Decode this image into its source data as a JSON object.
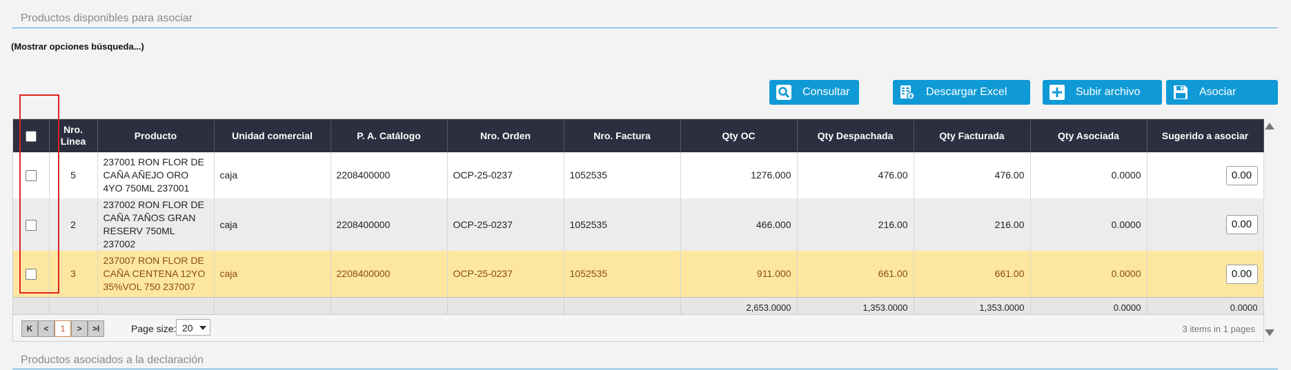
{
  "section_available": {
    "title": "Productos disponibles para asociar"
  },
  "search_toggle": "(Mostrar opciones búsqueda...)",
  "toolbar": {
    "consultar": "Consultar",
    "descargar_excel": "Descargar Excel",
    "subir_archivo": "Subir archivo",
    "asociar": "Asociar"
  },
  "columns": [
    "Nro. Línea",
    "Producto",
    "Unidad comercial",
    "P. A. Catálogo",
    "Nro. Orden",
    "Nro. Factura",
    "Qty OC",
    "Qty Despachada",
    "Qty Facturada",
    "Qty Asociada",
    "Sugerido a asociar"
  ],
  "rows": [
    {
      "linea": "5",
      "producto": "237001 RON FLOR DE CAÑA AÑEJO ORO 4YO 750ML 237001",
      "unidad": "caja",
      "catalogo": "2208400000",
      "orden": "OCP-25-0237",
      "factura": "1052535",
      "qty_oc": "1276.000",
      "qty_despachada": "476.00",
      "qty_facturada": "476.00",
      "qty_asociada": "0.0000",
      "sugerido": "0.00"
    },
    {
      "linea": "2",
      "producto": "237002 RON FLOR DE CAÑA 7AÑOS GRAN RESERV 750ML 237002",
      "unidad": "caja",
      "catalogo": "2208400000",
      "orden": "OCP-25-0237",
      "factura": "1052535",
      "qty_oc": "466.000",
      "qty_despachada": "216.00",
      "qty_facturada": "216.00",
      "qty_asociada": "0.0000",
      "sugerido": "0.00"
    },
    {
      "linea": "3",
      "producto": "237007 RON FLOR DE CAÑA CENTENA 12YO 35%VOL 750 237007",
      "unidad": "caja",
      "catalogo": "2208400000",
      "orden": "OCP-25-0237",
      "factura": "1052535",
      "qty_oc": "911.000",
      "qty_despachada": "661.00",
      "qty_facturada": "661.00",
      "qty_asociada": "0.0000",
      "sugerido": "0.00"
    }
  ],
  "totals": {
    "qty_oc": "2,653.0000",
    "qty_despachada": "1,353.0000",
    "qty_facturada": "1,353.0000",
    "qty_asociada": "0.0000",
    "sugerido": "0.0000"
  },
  "pager": {
    "first": "K",
    "prev": "<",
    "current_page": "1",
    "next": ">",
    "last": ">I",
    "page_size_label": "Page size:",
    "page_size": "20",
    "info": "3 items in 1 pages"
  },
  "section_associated": {
    "title": "Productos asociados a la declaración"
  },
  "colors": {
    "accent": "#0f9ad6",
    "header_bg": "#2c2f3f",
    "highlight_row": "#fde7a0",
    "highlight_text": "#8a4a12",
    "annotation": "#e02020"
  },
  "icons": [
    "search-icon",
    "excel-icon",
    "plus-icon",
    "save-icon",
    "scroll-up-icon",
    "scroll-down-icon"
  ]
}
